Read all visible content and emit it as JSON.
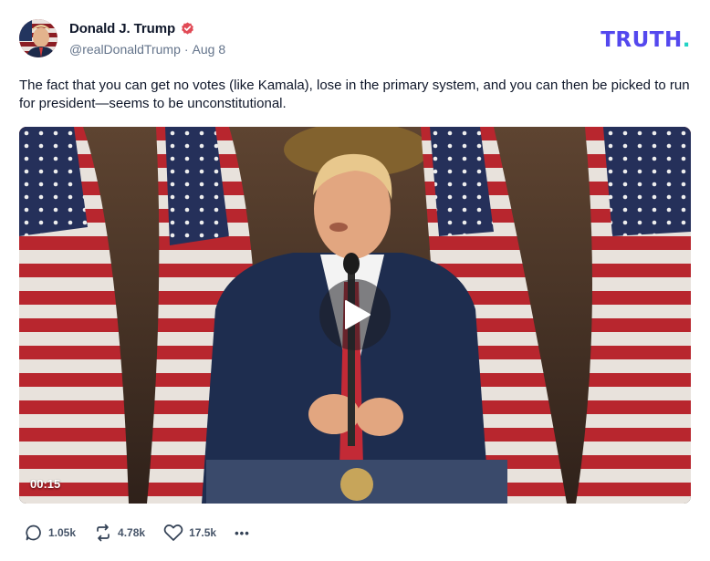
{
  "author": {
    "display_name": "Donald J. Trump",
    "handle": "@realDonaldTrump",
    "separator": "·",
    "date": "Aug 8",
    "verified_icon": "verified-badge-icon"
  },
  "brand": {
    "logo_word": "TRUTH",
    "logo_dot": ".",
    "colors": {
      "primary": "#5448ee",
      "accent": "#22d3c5"
    }
  },
  "post": {
    "text": "The fact that you can get no votes (like Kamala), lose in the primary system, and you can then be picked to run for president—seems to be unconstitutional."
  },
  "media": {
    "type": "video",
    "duration": "00:15",
    "play_icon": "play-icon"
  },
  "actions": {
    "replies": {
      "icon": "reply-icon",
      "count": "1.05k"
    },
    "retruths": {
      "icon": "retruth-icon",
      "count": "4.78k"
    },
    "likes": {
      "icon": "heart-icon",
      "count": "17.5k"
    },
    "more": {
      "icon": "more-icon",
      "label": "•••"
    }
  }
}
